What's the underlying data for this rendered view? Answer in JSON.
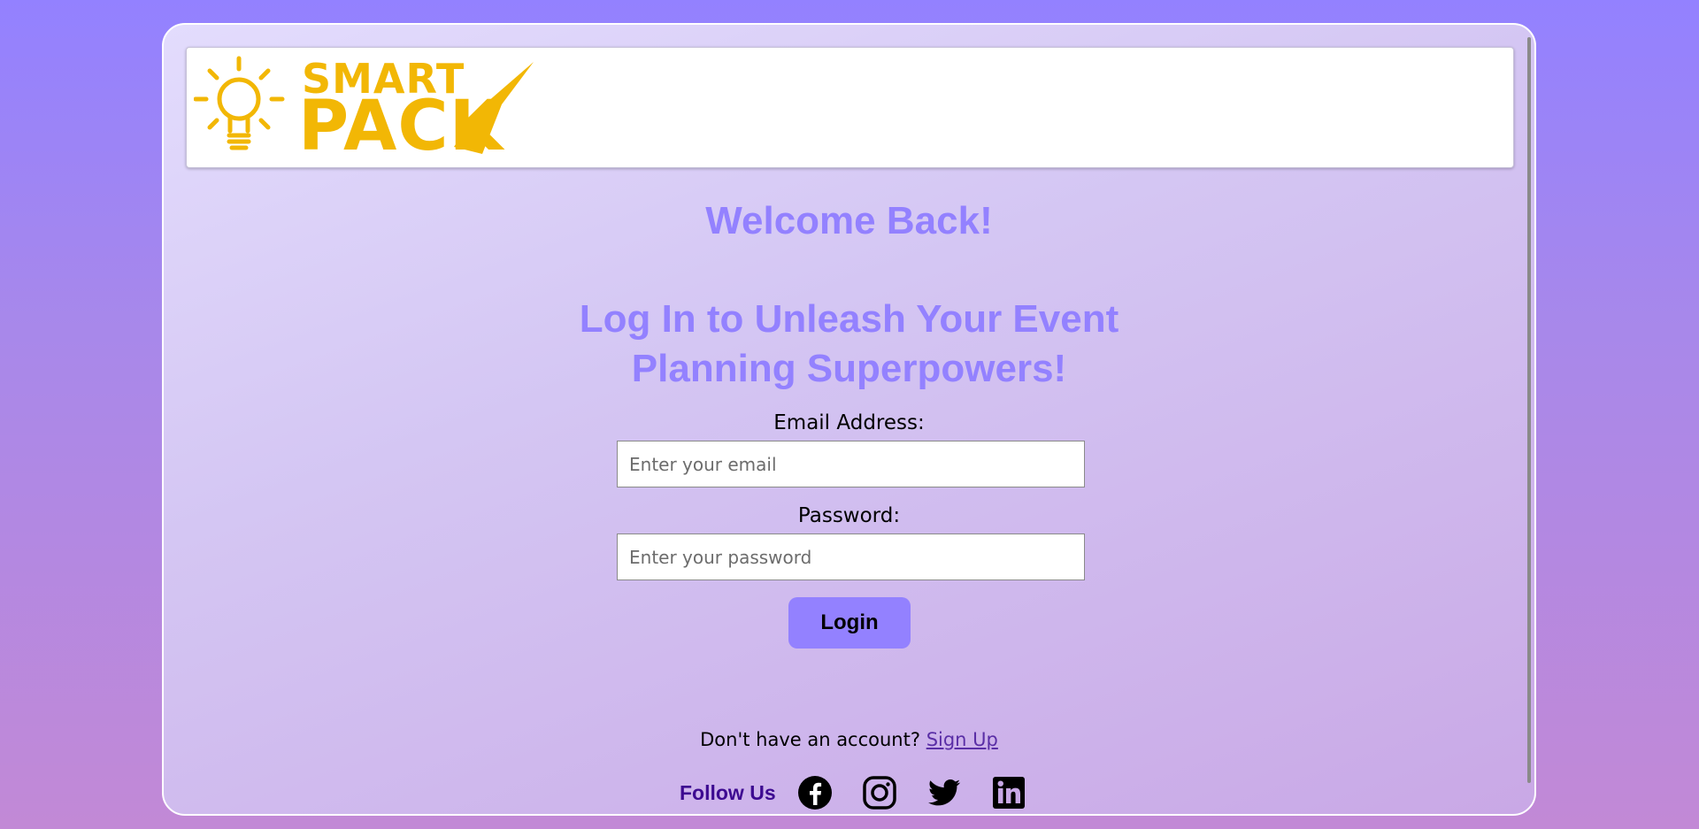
{
  "brand": {
    "logo_line1": "SMART",
    "logo_line2": "PACK",
    "logo_color": "#f2b705"
  },
  "main": {
    "welcome_title": "Welcome Back!",
    "subtitle_line1": "Log In to Unleash Your Event",
    "subtitle_line2": "Planning Superpowers!"
  },
  "form": {
    "email_label": "Email Address:",
    "email_placeholder": "Enter your email",
    "email_value": "",
    "password_label": "Password:",
    "password_placeholder": "Enter your password",
    "password_value": "",
    "login_label": "Login"
  },
  "signup": {
    "prompt": "Don't have an account? ",
    "link_label": "Sign Up"
  },
  "footer": {
    "follow_label": "Follow Us",
    "social_icons": [
      "facebook-icon",
      "instagram-icon",
      "twitter-icon",
      "linkedin-icon"
    ]
  },
  "colors": {
    "accent": "#9381ff",
    "follow_text": "#3d0a91",
    "link": "#5a2ea6"
  }
}
